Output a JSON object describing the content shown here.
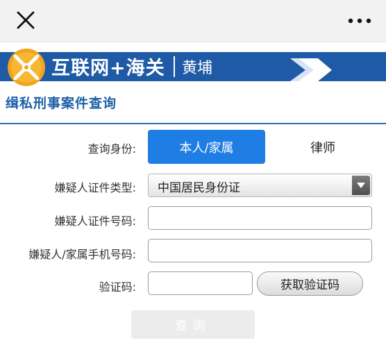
{
  "topbar": {
    "close_icon": "close-icon",
    "more_icon": "more-dots-icon"
  },
  "banner": {
    "title": "互联网+海关",
    "subtitle": "黄埔",
    "logo_icon": "customs-emblem-icon",
    "colors": {
      "band": "#1e5aa5",
      "logo": "#f2a41c"
    }
  },
  "page": {
    "title": "缉私刑事案件查询"
  },
  "form": {
    "identity": {
      "label": "查询身份:",
      "options": [
        "本人/家属",
        "律师"
      ],
      "selected": "本人/家属"
    },
    "id_type": {
      "label": "嫌疑人证件类型:",
      "value": "中国居民身份证"
    },
    "id_number": {
      "label": "嫌疑人证件号码:",
      "value": "",
      "placeholder": ""
    },
    "phone": {
      "label": "嫌疑人/家属手机号码:",
      "value": "",
      "placeholder": ""
    },
    "captcha": {
      "label": "验证码:",
      "value": "",
      "button_label": "获取验证码"
    },
    "submit_label": "查询"
  },
  "colors": {
    "accent": "#1f7ee4",
    "title_blue": "#1d5fa8",
    "disabled_button": "#ececec"
  }
}
